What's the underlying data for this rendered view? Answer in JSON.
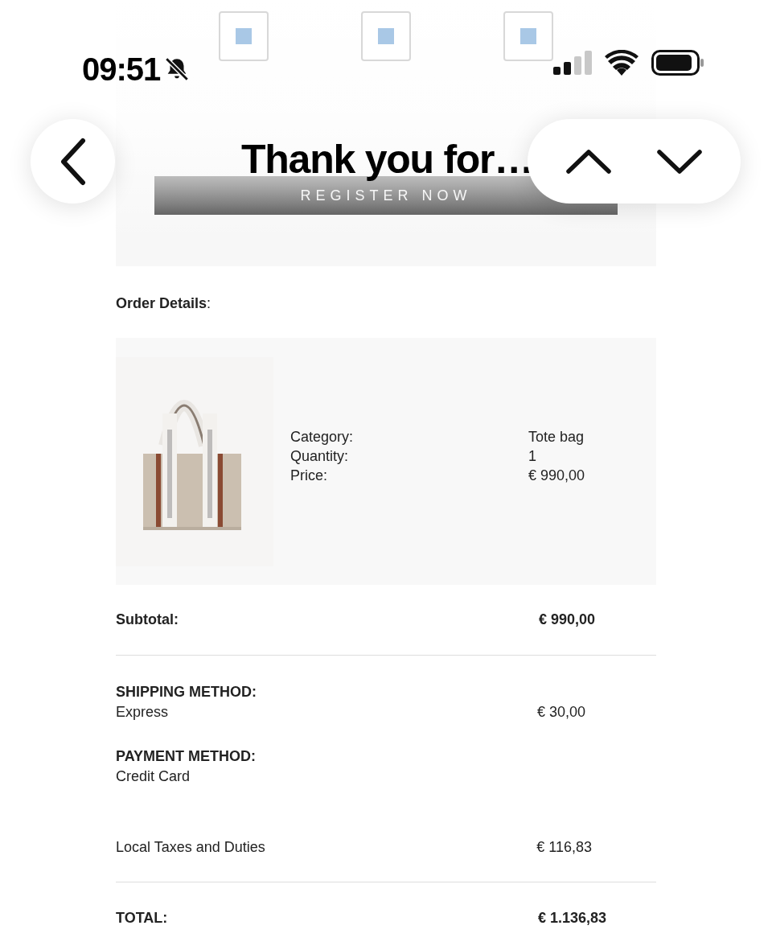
{
  "status_bar": {
    "time": "09:51"
  },
  "nav": {
    "title": "Thank you for…"
  },
  "promo": {
    "button": "REGISTER NOW"
  },
  "order": {
    "heading": "**Order Details**:",
    "item": {
      "fields": [
        {
          "label": "Category:",
          "value": "Tote bag"
        },
        {
          "label": "Quantity:",
          "value": "1"
        },
        {
          "label": "Price:",
          "value": "€ 990,00"
        }
      ]
    }
  },
  "summary": {
    "subtotal": {
      "label": "Subtotal:",
      "value": "€ 990,00"
    },
    "shipping": {
      "label": "SHIPPING METHOD:",
      "method": "Express",
      "value": "€ 30,00"
    },
    "payment": {
      "label": "PAYMENT METHOD:",
      "method": "Credit Card"
    },
    "taxes": {
      "label": "Local Taxes and Duties",
      "value": "€ 116,83"
    },
    "total": {
      "label": "TOTAL:",
      "value": "€ 1.136,83"
    }
  }
}
